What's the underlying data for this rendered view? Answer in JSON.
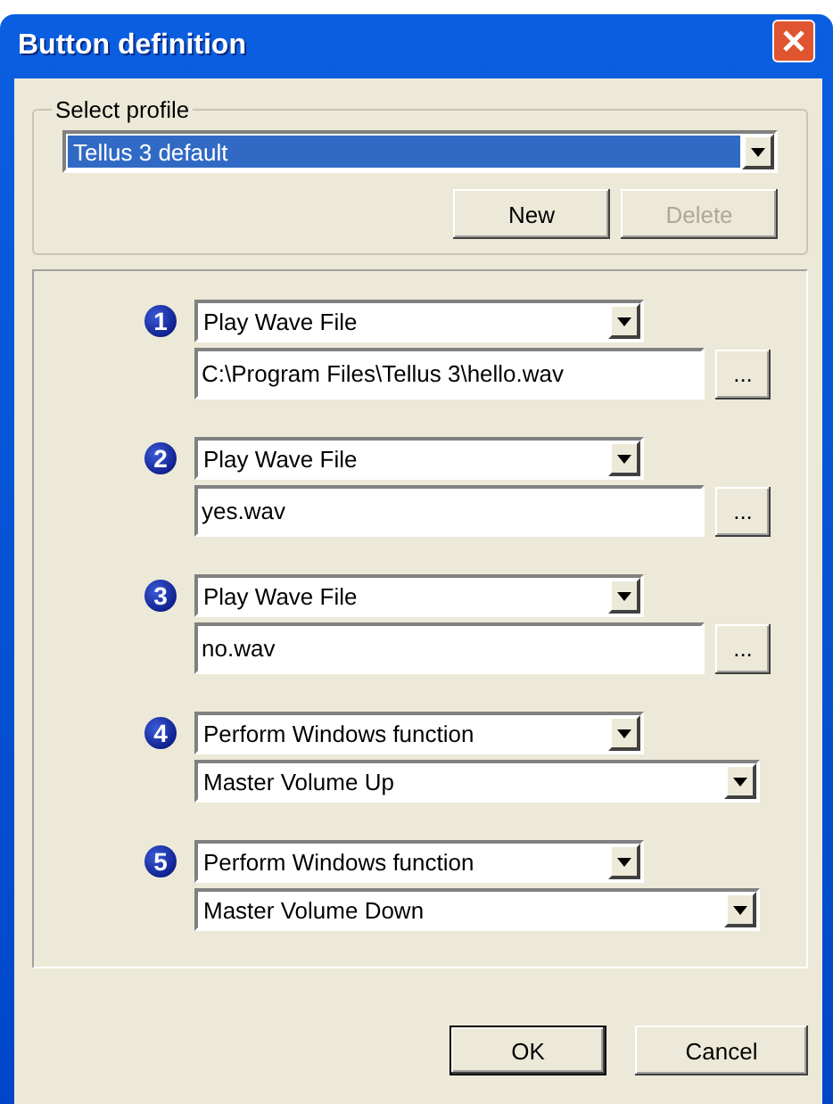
{
  "window": {
    "title": "Button definition"
  },
  "profile": {
    "label": "Select profile",
    "value": "Tellus 3 default",
    "buttons": [
      {
        "label": "New",
        "disabled": false
      },
      {
        "label": "Delete",
        "disabled": true
      }
    ]
  },
  "buttons_config": [
    {
      "number": "1",
      "kind": "file",
      "action": "Play Wave File",
      "value": "C:\\Program Files\\Tellus 3\\hello.wav",
      "browse": "..."
    },
    {
      "number": "2",
      "kind": "file",
      "action": "Play Wave File",
      "value": "yes.wav",
      "browse": "..."
    },
    {
      "number": "3",
      "kind": "file",
      "action": "Play Wave File",
      "value": "no.wav",
      "browse": "..."
    },
    {
      "number": "4",
      "kind": "function",
      "action": "Perform Windows function",
      "value": "Master Volume Up"
    },
    {
      "number": "5",
      "kind": "function",
      "action": "Perform Windows function",
      "value": "Master Volume Down"
    }
  ],
  "footer": {
    "ok": "OK",
    "cancel": "Cancel"
  }
}
